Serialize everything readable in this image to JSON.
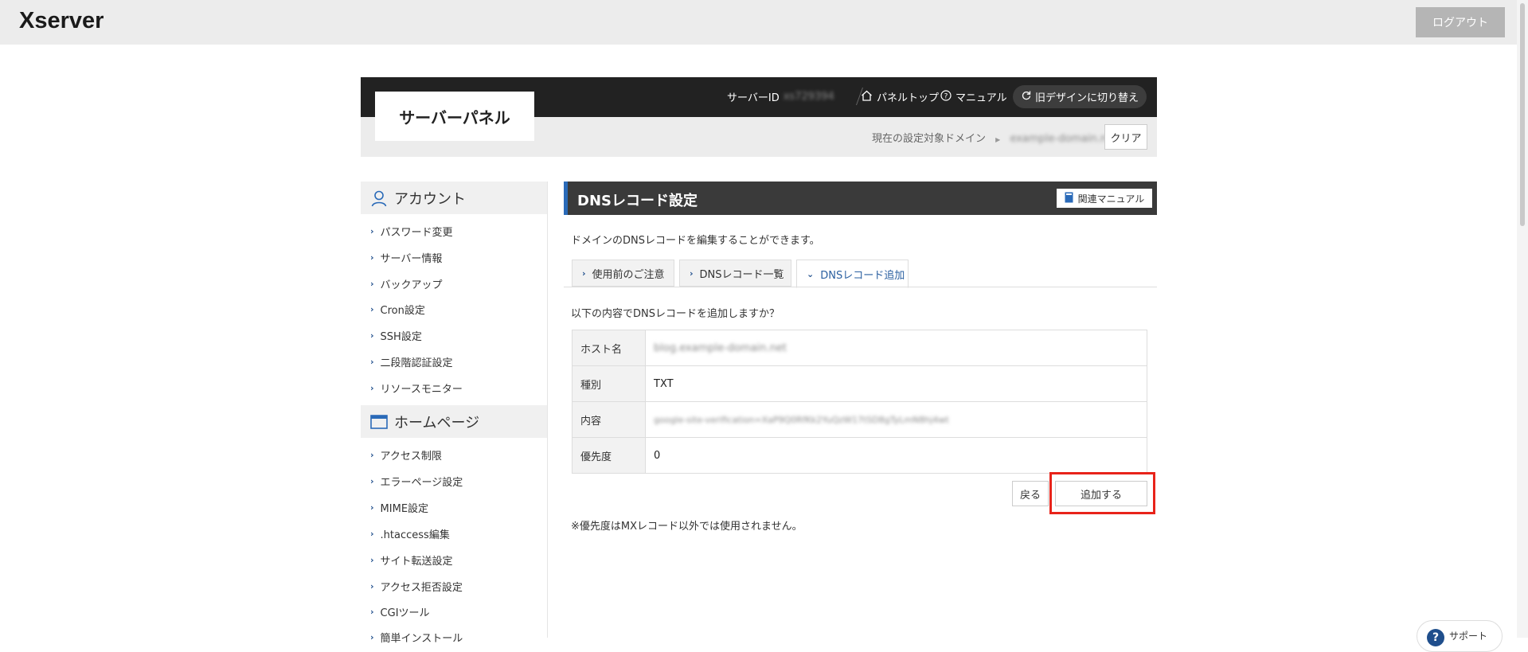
{
  "app": {
    "logo": "Xserver",
    "logout_label": "ログアウト"
  },
  "panel": {
    "title": "サーバーパネル",
    "server_id_label": "サーバーID",
    "server_id_value": "xs729394",
    "links": {
      "panel_top": "パネルトップ",
      "manual": "マニュアル",
      "old_design": "旧デザインに切り替え"
    },
    "domain_label": "現在の設定対象ドメイン",
    "domain_value": "example-domain.net",
    "clear_label": "クリア"
  },
  "sidebar": {
    "account": {
      "title": "アカウント",
      "items": [
        "パスワード変更",
        "サーバー情報",
        "バックアップ",
        "Cron設定",
        "SSH設定",
        "二段階認証設定",
        "リソースモニター"
      ]
    },
    "homepage": {
      "title": "ホームページ",
      "items": [
        "アクセス制限",
        "エラーページ設定",
        "MIME設定",
        ".htaccess編集",
        "サイト転送設定",
        "アクセス拒否設定",
        "CGIツール",
        "簡単インストール"
      ]
    }
  },
  "main": {
    "title": "DNSレコード設定",
    "manual_label": "関連マニュアル",
    "description": "ドメインのDNSレコードを編集することができます。",
    "tabs": [
      {
        "label": "使用前のご注意",
        "active": false
      },
      {
        "label": "DNSレコード一覧",
        "active": false
      },
      {
        "label": "DNSレコード追加",
        "active": true
      }
    ],
    "confirm_text": "以下の内容でDNSレコードを追加しますか？",
    "record": {
      "host_label": "ホスト名",
      "host_value": "blog.example-domain.net",
      "type_label": "種別",
      "type_value": "TXT",
      "content_label": "内容",
      "content_value": "google-site-verification=XaP9Q0RfKk2YuQzW17tSD8gTyLmN8hj4wt",
      "priority_label": "優先度",
      "priority_value": "0"
    },
    "back_label": "戻る",
    "add_label": "追加する",
    "note": "※優先度はMXレコード以外では使用されません。"
  },
  "support": {
    "label": "サポート"
  },
  "colors": {
    "accent_blue": "#2a6ab8",
    "highlight_red": "#e8231a",
    "header_dark": "#222222"
  }
}
